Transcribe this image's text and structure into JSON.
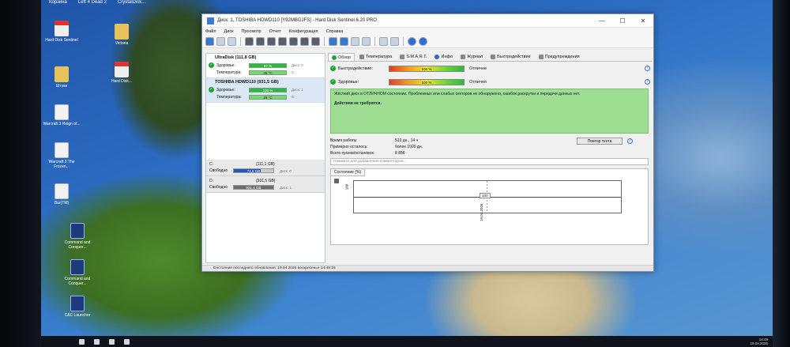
{
  "desktop": {
    "top_labels": [
      "Корзина",
      "Left 4 Dead 2",
      "CrystalDisk..."
    ],
    "icons": [
      {
        "label": "Hard Disk Sentinel",
        "kind": "hdd"
      },
      {
        "label": "Victoria",
        "kind": "folder"
      },
      {
        "label": "Hard Disk...",
        "kind": "hdd"
      },
      {
        "label": "Штуки",
        "kind": "folder"
      },
      {
        "label": "Warcraft 3 Reign of...",
        "kind": "file"
      },
      {
        "label": "Warcraft 3 The Frozen...",
        "kind": "file"
      },
      {
        "label": "Bar(TM)",
        "kind": "file"
      },
      {
        "label": "Command and Conquer...",
        "kind": "cmd"
      },
      {
        "label": "Command and Conquer...",
        "kind": "cmd"
      },
      {
        "label": "C&C Launcher",
        "kind": "cmd"
      }
    ]
  },
  "window": {
    "title": "Диск: 1, TOSHIBA HDWD110 [Y92MBGJFS]  -  Hard Disk Sentinel 6.20 PRO",
    "controls": {
      "minimize": "—",
      "maximize": "☐",
      "close": "✕"
    },
    "menu": [
      "Файл",
      "Диск",
      "Просмотр",
      "Отчет",
      "Конфигурация",
      "Справка"
    ]
  },
  "disks": [
    {
      "name": "UltraDisk (111,8 GB)",
      "health_label": "Здоровье:",
      "health": "97 %",
      "health_ext": "Диск: 0",
      "temp_label": "Температура:",
      "temp": "40 °C",
      "temp_ext": "C:"
    },
    {
      "name": "TOSHIBA HDWD110 (931,5 GB)",
      "health_label": "Здоровье:",
      "health": "100 %",
      "health_ext": "Диск: 1",
      "temp_label": "Температура:",
      "temp": "25 °C",
      "temp_ext": "D:"
    }
  ],
  "volumes": [
    {
      "letter": "C:",
      "size": "(111,1 GB)",
      "free_label": "Свободно",
      "free": "74,5 GB",
      "disk": "Диск: 0",
      "fraction": 0.67
    },
    {
      "letter": "D:",
      "size": "(931,5 GB)",
      "free_label": "Свободно",
      "free": "931,4 GB",
      "disk": "Диск: 1",
      "fraction": 1.0
    }
  ],
  "tabs": [
    "Обзор",
    "Температура",
    "S.M.A.R.T.",
    "Инфо",
    "Журнал",
    "Быстродействие",
    "Предупреждения"
  ],
  "overview": {
    "perf_label": "Быстродействие:",
    "perf_value": "100 %",
    "perf_text": "Отлично",
    "health_label": "Здоровье:",
    "health_value": "100 %",
    "health_text": "Отлично",
    "status_text": "Жёсткий диск в ОТЛИЧНОМ состоянии. Проблемных или слабых секторов не обнаружено, ошибок раскрутки и передачи данных нет.",
    "action_text": "Действия не требуются.",
    "runtime_label": "Время работы",
    "runtime": "513 дн., 14 ч",
    "remain_label": "Примерно осталось:",
    "remain": "более 1000 дн.",
    "starts_label": "Всего пусков/остановок:",
    "starts": "8 850",
    "retest_button": "Повтор теста",
    "comment_placeholder": "Нажмите для добавления комментария..."
  },
  "chart": {
    "tab_label": "Состояние (%)",
    "point_label": "100",
    "y_tick": "100",
    "x_tick": "19.04.2026"
  },
  "chart_data": {
    "type": "line",
    "x": [
      "19.04.2026"
    ],
    "series": [
      {
        "values": [
          100
        ]
      }
    ],
    "ylim": [
      0,
      100
    ]
  },
  "status_bar": "Состояние последнего обновления: 19.04.2026 воскресенье 14:49:16",
  "taskbar": {
    "time": "14:49",
    "date": "19.04.2026"
  }
}
